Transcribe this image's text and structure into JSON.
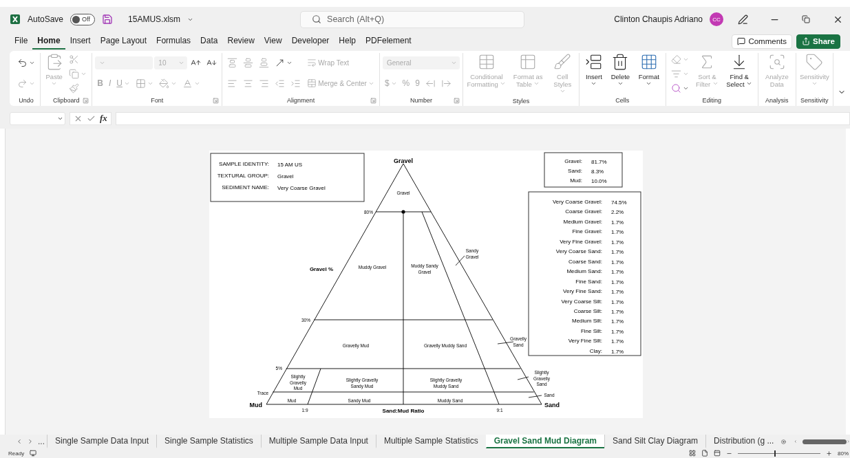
{
  "title_bar": {
    "autosave_label": "AutoSave",
    "autosave_toggle": {
      "label": "Off",
      "on": false
    },
    "file_name": "15AMUS.xlsm",
    "search_placeholder": "Search (Alt+Q)",
    "user_name": "Clinton Chaupis Adriano",
    "avatar_initials": "CC"
  },
  "menu_tabs": [
    {
      "label": "File",
      "selected": false
    },
    {
      "label": "Home",
      "selected": true
    },
    {
      "label": "Insert",
      "selected": false
    },
    {
      "label": "Page Layout",
      "selected": false
    },
    {
      "label": "Formulas",
      "selected": false
    },
    {
      "label": "Data",
      "selected": false
    },
    {
      "label": "Review",
      "selected": false
    },
    {
      "label": "View",
      "selected": false
    },
    {
      "label": "Developer",
      "selected": false
    },
    {
      "label": "Help",
      "selected": false
    },
    {
      "label": "PDFelement",
      "selected": false
    }
  ],
  "header_buttons": [
    {
      "label": "Comments",
      "kind": "outline"
    },
    {
      "label": "Share",
      "kind": "primary"
    }
  ],
  "ribbon_groups": [
    {
      "name": "Undo",
      "launcher": false,
      "columns": [
        {
          "kind": "stack",
          "rows": [
            [
              {
                "kind": "icon",
                "caret": true,
                "disabled": false
              }
            ],
            [
              {
                "kind": "icon",
                "caret": true,
                "disabled": true
              }
            ]
          ]
        }
      ]
    },
    {
      "name": "Clipboard",
      "launcher": true,
      "columns": [
        {
          "kind": "large",
          "label": "Paste",
          "caret": true,
          "disabled": true
        },
        {
          "kind": "stack",
          "rows": [
            [
              {
                "kind": "icon",
                "caret": false,
                "disabled": true
              }
            ],
            [
              {
                "kind": "icon",
                "caret": true,
                "disabled": true
              }
            ],
            [
              {
                "kind": "icon",
                "caret": false,
                "disabled": true
              }
            ]
          ]
        }
      ]
    },
    {
      "name": "Font",
      "launcher": true,
      "columns": [
        {
          "kind": "stack",
          "rows": [
            [
              {
                "kind": "select",
                "disabled": true
              },
              {
                "kind": "select",
                "value": "10",
                "disabled": true
              },
              {
                "kind": "icon",
                "caret": false,
                "disabled": false
              },
              {
                "kind": "icon",
                "caret": false,
                "disabled": false
              }
            ],
            [
              {
                "kind": "text",
                "label": "B",
                "caret": false,
                "disabled": true
              },
              {
                "kind": "text",
                "label": "I",
                "caret": false,
                "disabled": true
              },
              {
                "kind": "text",
                "label": "U",
                "caret": true,
                "disabled": true
              },
              {
                "kind": "icon",
                "caret": true,
                "disabled": true
              },
              {
                "kind": "icon",
                "caret": true,
                "disabled": true
              },
              {
                "kind": "icon",
                "caret": true,
                "disabled": true
              }
            ]
          ]
        }
      ]
    },
    {
      "name": "Alignment",
      "launcher": true,
      "columns": [
        {
          "kind": "stack",
          "rows": [
            [
              {
                "kind": "icon",
                "caret": false,
                "disabled": true
              },
              {
                "kind": "icon",
                "caret": false,
                "disabled": true
              },
              {
                "kind": "icon",
                "caret": false,
                "disabled": true
              },
              {
                "kind": "icon",
                "caret": true,
                "disabled": false
              }
            ],
            [
              {
                "kind": "icon",
                "caret": false,
                "disabled": true
              },
              {
                "kind": "icon",
                "caret": false,
                "disabled": true
              },
              {
                "kind": "icon",
                "caret": false,
                "disabled": true
              },
              {
                "kind": "icon",
                "caret": false,
                "disabled": true
              },
              {
                "kind": "icon",
                "caret": false,
                "disabled": true
              }
            ]
          ]
        },
        {
          "kind": "stack",
          "rows": [
            [
              {
                "kind": "small",
                "label": "Wrap Text",
                "caret": false,
                "disabled": true
              }
            ],
            [
              {
                "kind": "small",
                "label": "Merge & Center",
                "caret": true,
                "disabled": true
              }
            ]
          ]
        }
      ]
    },
    {
      "name": "Number",
      "launcher": true,
      "columns": [
        {
          "kind": "stack",
          "rows": [
            [
              {
                "kind": "select",
                "value": "General",
                "disabled": true
              }
            ],
            [
              {
                "kind": "text",
                "label": "$",
                "caret": true,
                "disabled": true
              },
              {
                "kind": "text",
                "label": "%",
                "caret": false,
                "disabled": true
              },
              {
                "kind": "text",
                "label": "9",
                "caret": false,
                "disabled": true
              },
              {
                "kind": "icon",
                "caret": false,
                "disabled": true
              },
              {
                "kind": "icon",
                "caret": false,
                "disabled": true
              }
            ]
          ]
        }
      ]
    },
    {
      "name": "Styles",
      "launcher": false,
      "columns": [
        {
          "kind": "large",
          "label": "Conditional Formatting",
          "caret": true,
          "disabled": true
        },
        {
          "kind": "large",
          "label": "Format as Table",
          "caret": true,
          "disabled": true
        },
        {
          "kind": "large",
          "label": "Cell Styles",
          "caret": true,
          "disabled": true
        }
      ]
    },
    {
      "name": "Cells",
      "launcher": false,
      "columns": [
        {
          "kind": "large",
          "label": "Insert",
          "caret": true,
          "disabled": false
        },
        {
          "kind": "large",
          "label": "Delete",
          "caret": true,
          "disabled": false
        },
        {
          "kind": "large",
          "label": "Format",
          "caret": true,
          "disabled": false
        }
      ]
    },
    {
      "name": "Editing",
      "launcher": false,
      "columns": [
        {
          "kind": "stack",
          "rows": [
            [
              {
                "kind": "icon",
                "caret": true,
                "disabled": true
              }
            ],
            [
              {
                "kind": "icon",
                "caret": true,
                "disabled": true
              }
            ],
            [
              {
                "kind": "icon",
                "caret": true,
                "disabled": false
              }
            ]
          ]
        },
        {
          "kind": "large",
          "label": "Sort & Filter",
          "caret": true,
          "disabled": true
        },
        {
          "kind": "large",
          "label": "Find & Select",
          "caret": true,
          "disabled": false
        }
      ]
    },
    {
      "name": "Analysis",
      "launcher": false,
      "columns": [
        {
          "kind": "large",
          "label": "Analyze Data",
          "caret": false,
          "disabled": true
        }
      ]
    },
    {
      "name": "Sensitivity",
      "launcher": false,
      "columns": [
        {
          "kind": "large",
          "label": "Sensitivity",
          "caret": true,
          "disabled": true
        }
      ]
    }
  ],
  "formula_bar": {
    "function_label": "fx"
  },
  "diagram": {
    "sample_info": [
      {
        "label": "SAMPLE IDENTITY:",
        "value": "15 AM US"
      },
      {
        "label": "TEXTURAL GROUP:",
        "value": "Gravel"
      },
      {
        "label": "SEDIMENT NAME:",
        "value": "Very Coarse Gravel"
      }
    ],
    "composition": [
      {
        "label": "Gravel:",
        "value": "81.7%"
      },
      {
        "label": "Sand:",
        "value": "8.3%"
      },
      {
        "label": "Mud:",
        "value": "10.0%"
      }
    ],
    "size_fractions": [
      {
        "label": "Very Coarse Gravel:",
        "value": "74.5%"
      },
      {
        "label": "Coarse Gravel:",
        "value": "2.2%"
      },
      {
        "label": "Medium Gravel:",
        "value": "1.7%"
      },
      {
        "label": "Fine Gravel:",
        "value": "1.7%"
      },
      {
        "label": "Very Fine Gravel:",
        "value": "1.7%"
      },
      {
        "label": "Very Coarse Sand:",
        "value": "1.7%"
      },
      {
        "label": "Coarse Sand:",
        "value": "1.7%"
      },
      {
        "label": "Medium Sand:",
        "value": "1.7%"
      },
      {
        "label": "Fine Sand:",
        "value": "1.7%"
      },
      {
        "label": "Very Fine Sand:",
        "value": "1.7%"
      },
      {
        "label": "Very Coarse Silt:",
        "value": "1.7%"
      },
      {
        "label": "Coarse Silt:",
        "value": "1.7%"
      },
      {
        "label": "Medium Silt:",
        "value": "1.7%"
      },
      {
        "label": "Fine Silt:",
        "value": "1.7%"
      },
      {
        "label": "Very Fine Silt:",
        "value": "1.7%"
      },
      {
        "label": "Clay:",
        "value": "1.7%"
      }
    ],
    "apex_labels": [
      "Gravel",
      "Mud",
      "Sand"
    ],
    "level_labels": [
      "80%",
      "30%",
      "5%",
      "Trace"
    ],
    "ratio_labels": [
      "1:9",
      "9:1"
    ],
    "axis_title": "Gravel %",
    "ratio_title": "Sand:Mud Ratio",
    "regions": [
      {
        "lines": [
          "Gravel"
        ]
      },
      {
        "lines": [
          "Muddy Gravel"
        ]
      },
      {
        "lines": [
          "Muddy Sandy",
          "Gravel"
        ]
      },
      {
        "lines": [
          "Gravelly Mud"
        ]
      },
      {
        "lines": [
          "Gravelly Muddy Sand"
        ]
      },
      {
        "lines": [
          "Slightly",
          "Gravelly",
          "Mud"
        ]
      },
      {
        "lines": [
          "Slightly Gravelly",
          "Sandy Mud"
        ]
      },
      {
        "lines": [
          "Slightly Gravelly",
          "Muddy Sand"
        ]
      },
      {
        "lines": [
          "Mud"
        ]
      },
      {
        "lines": [
          "Sandy Mud"
        ]
      },
      {
        "lines": [
          "Muddy Sand"
        ]
      }
    ],
    "outside_regions": [
      {
        "lines": [
          "Sandy",
          "Gravel"
        ]
      },
      {
        "lines": [
          "Gravelly",
          "Sand"
        ]
      },
      {
        "lines": [
          "Slightly",
          "Gravelly",
          "Sand"
        ]
      },
      {
        "lines": [
          "Sand"
        ]
      }
    ],
    "sample_point": {
      "kind": "dot"
    }
  },
  "sheet_tabs": [
    {
      "label": "Single Sample Data Input",
      "selected": false
    },
    {
      "label": "Single Sample Statistics",
      "selected": false
    },
    {
      "label": "Multiple Sample Data Input",
      "selected": false
    },
    {
      "label": "Multiple Sample Statistics",
      "selected": false
    },
    {
      "label": "Gravel Sand Mud Diagram",
      "selected": true
    },
    {
      "label": "Sand Silt Clay Diagram",
      "selected": false
    },
    {
      "label": "Distribution (g ...",
      "selected": false
    }
  ],
  "sheet_nav_more": "...",
  "status_bar": {
    "status": "Ready",
    "zoom_slider": {
      "level": 0.45
    },
    "zoom": "80%"
  }
}
